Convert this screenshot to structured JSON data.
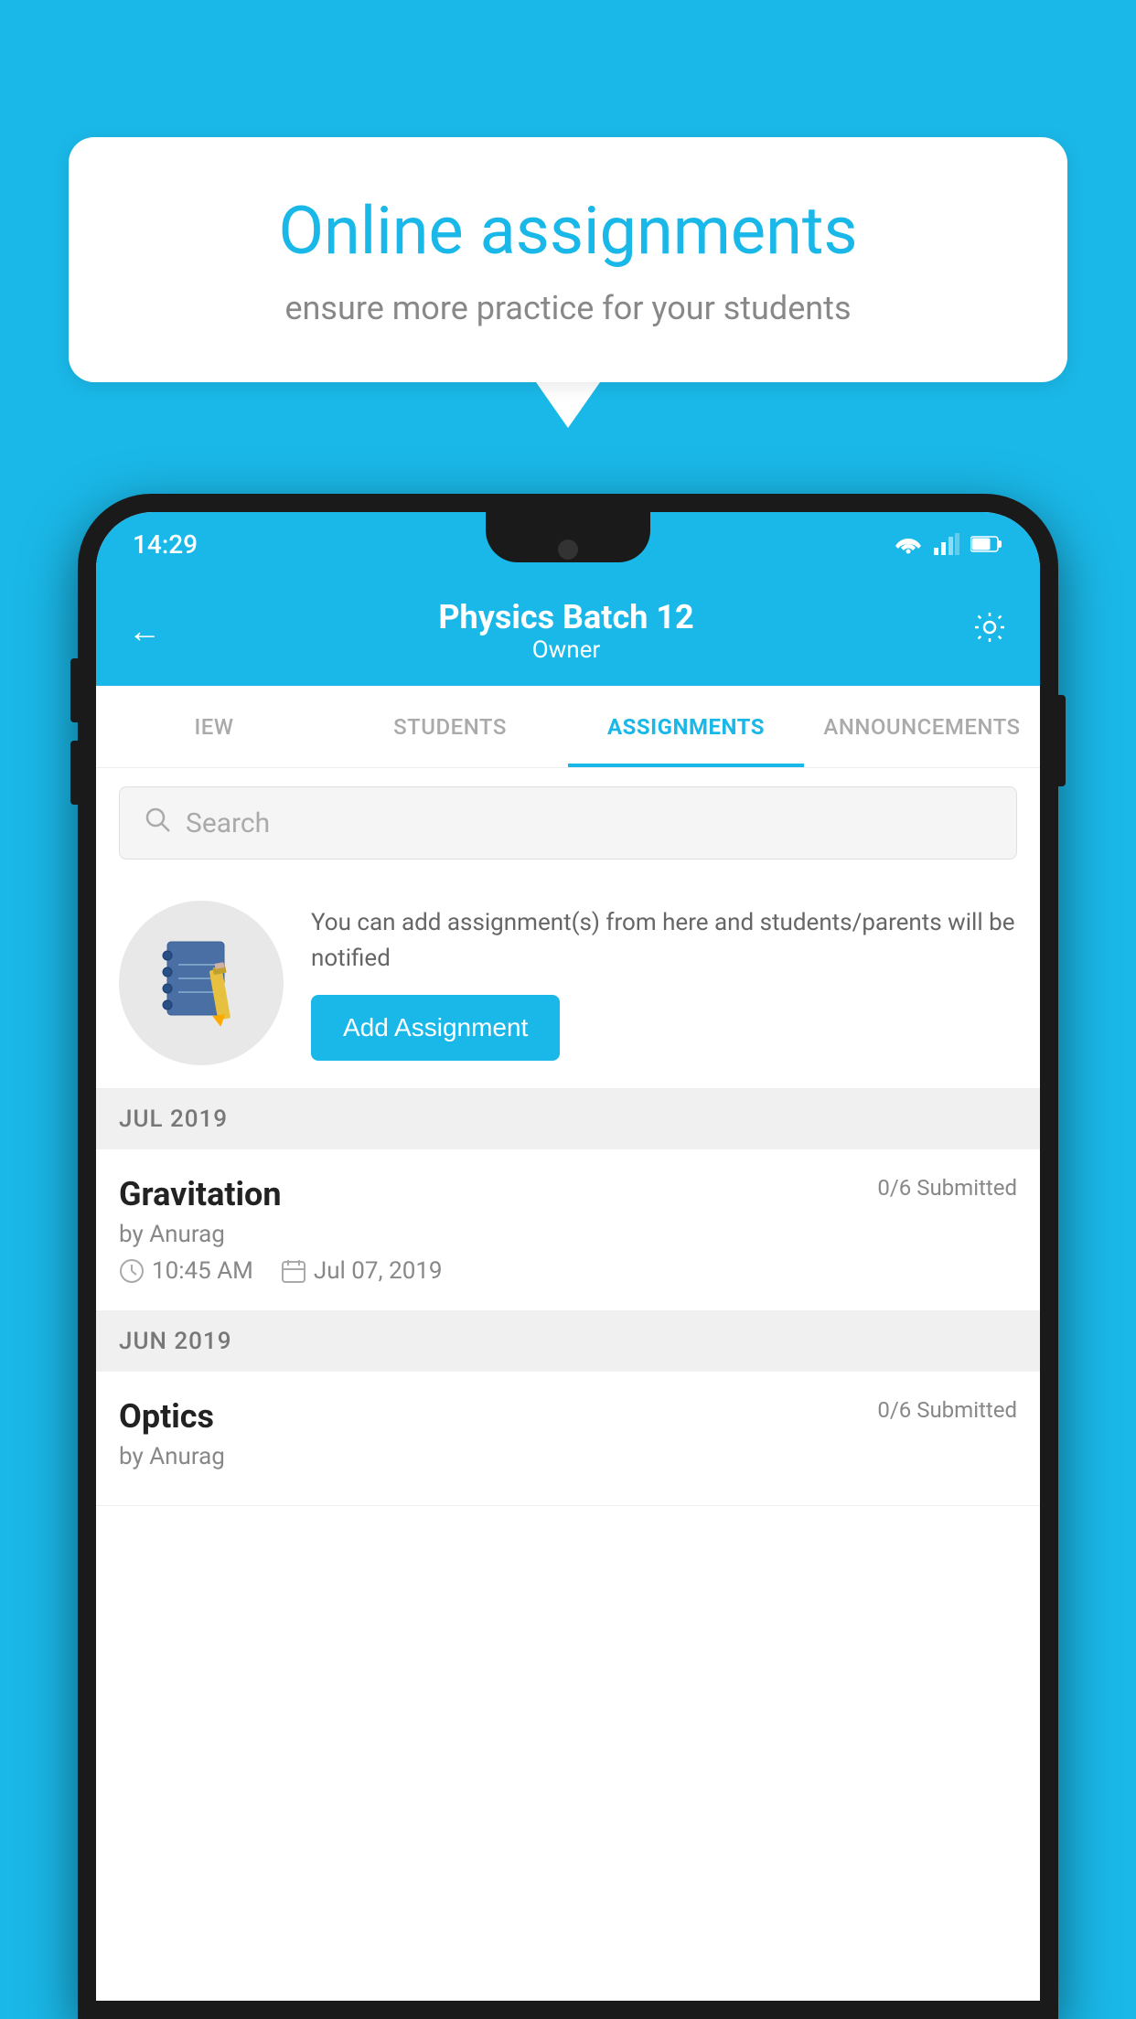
{
  "background_color": "#1ab8e8",
  "speech_bubble": {
    "title": "Online assignments",
    "subtitle": "ensure more practice for your students"
  },
  "status_bar": {
    "time": "14:29",
    "icons": [
      "wifi",
      "signal",
      "battery"
    ]
  },
  "app_bar": {
    "back_label": "←",
    "title": "Physics Batch 12",
    "subtitle": "Owner",
    "settings_label": "⚙"
  },
  "tabs": [
    {
      "label": "IEW",
      "active": false
    },
    {
      "label": "STUDENTS",
      "active": false
    },
    {
      "label": "ASSIGNMENTS",
      "active": true
    },
    {
      "label": "ANNOUNCEMENTS",
      "active": false
    }
  ],
  "search": {
    "placeholder": "Search"
  },
  "promo_card": {
    "text": "You can add assignment(s) from here and students/parents will be notified",
    "button_label": "Add Assignment"
  },
  "month_sections": [
    {
      "month_label": "JUL 2019",
      "assignments": [
        {
          "title": "Gravitation",
          "submitted": "0/6 Submitted",
          "author": "by Anurag",
          "time": "10:45 AM",
          "date": "Jul 07, 2019"
        }
      ]
    },
    {
      "month_label": "JUN 2019",
      "assignments": [
        {
          "title": "Optics",
          "submitted": "0/6 Submitted",
          "author": "by Anurag",
          "time": "",
          "date": ""
        }
      ]
    }
  ]
}
